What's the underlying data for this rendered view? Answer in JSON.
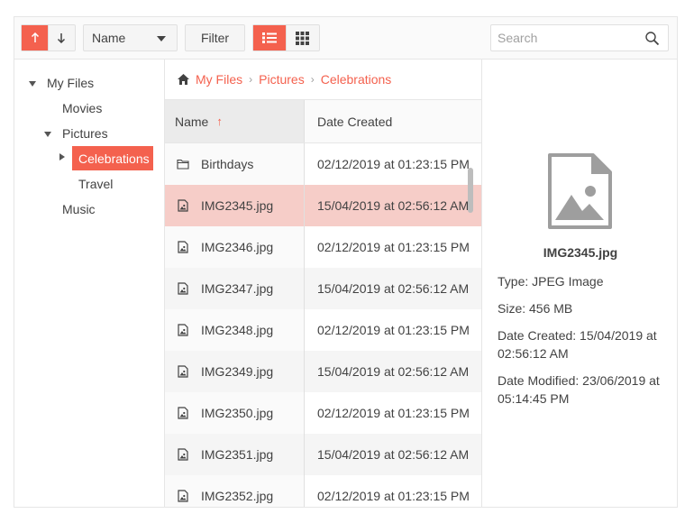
{
  "toolbar": {
    "sort_ascending_icon": "arrow-up",
    "sort_descending_icon": "arrow-down",
    "sort_field": "Name",
    "filter_label": "Filter",
    "view_list_icon": "list",
    "view_grid_icon": "grid",
    "search_placeholder": "Search",
    "search_value": ""
  },
  "tree": {
    "items": [
      {
        "label": "My Files",
        "expanded": true,
        "level": 0
      },
      {
        "label": "Movies",
        "level": 1
      },
      {
        "label": "Pictures",
        "expanded": true,
        "level": 1
      },
      {
        "label": "Celebrations",
        "expanded": false,
        "level": 2,
        "selected": true
      },
      {
        "label": "Travel",
        "level": 2
      },
      {
        "label": "Music",
        "level": 1
      }
    ]
  },
  "breadcrumb": {
    "items": [
      "My Files",
      "Pictures",
      "Celebrations"
    ],
    "separator": "›"
  },
  "grid": {
    "columns": [
      "Name",
      "Date Created"
    ],
    "sort_indicator": "↑",
    "rows": [
      {
        "name": "Birthdays",
        "type": "folder",
        "date": "02/12/2019 at 01:23:15 PM"
      },
      {
        "name": "IMG2345.jpg",
        "type": "image",
        "date": "15/04/2019 at 02:56:12 AM",
        "selected": true
      },
      {
        "name": "IMG2346.jpg",
        "type": "image",
        "date": "02/12/2019 at 01:23:15 PM"
      },
      {
        "name": "IMG2347.jpg",
        "type": "image",
        "date": "15/04/2019 at 02:56:12 AM"
      },
      {
        "name": "IMG2348.jpg",
        "type": "image",
        "date": "02/12/2019 at 01:23:15 PM"
      },
      {
        "name": "IMG2349.jpg",
        "type": "image",
        "date": "15/04/2019 at 02:56:12 AM"
      },
      {
        "name": "IMG2350.jpg",
        "type": "image",
        "date": "02/12/2019 at 01:23:15 PM"
      },
      {
        "name": "IMG2351.jpg",
        "type": "image",
        "date": "15/04/2019 at 02:56:12 AM"
      },
      {
        "name": "IMG2352.jpg",
        "type": "image",
        "date": "02/12/2019 at 01:23:15 PM"
      }
    ]
  },
  "details": {
    "file_name": "IMG2345.jpg",
    "type_line": "Type: JPEG Image",
    "size_line": "Size: 456 MB",
    "created_line_1": "Date Created: 15/04/2019 at",
    "created_line_2": "02:56:12 AM",
    "modified_line_1": "Date Modified: 23/06/2019 at",
    "modified_line_2": "05:14:45 PM"
  },
  "colors": {
    "accent": "#f4614e",
    "selected_row": "#f6cdc8"
  }
}
